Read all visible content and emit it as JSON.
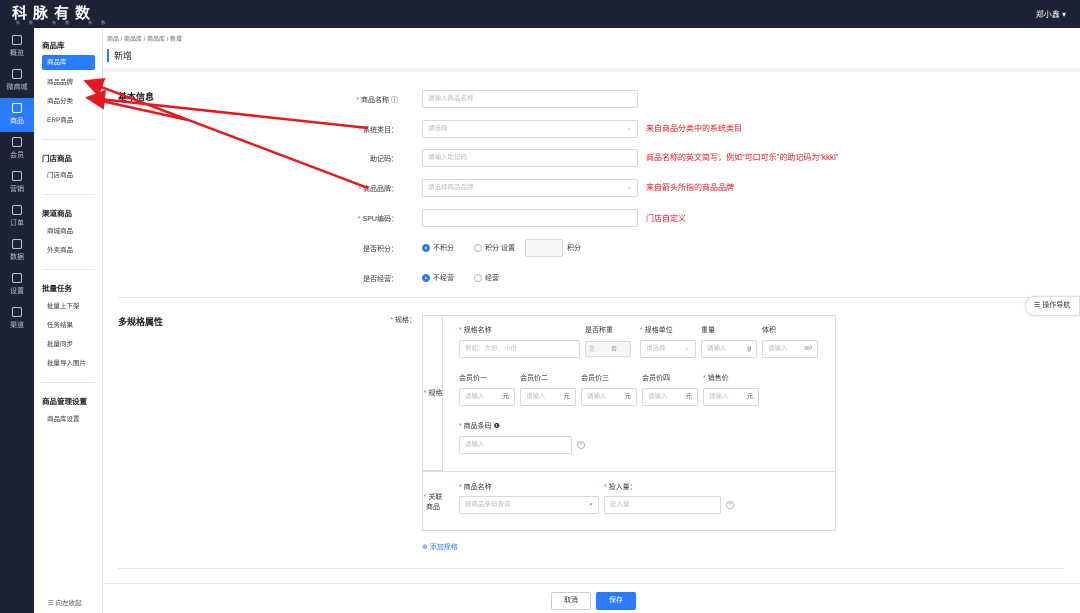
{
  "app": {
    "logo": "科脉有数",
    "logo_sub": "有数 有数 有数",
    "user": "郑小鑫 ▾"
  },
  "leftnav": [
    "概览",
    "微商城",
    "商品",
    "会员",
    "营销",
    "订单",
    "数据",
    "设置",
    "渠道"
  ],
  "subnav": {
    "groups": [
      "商品库",
      "门店商品",
      "渠道商品",
      "批量任务",
      "商品管理设置"
    ],
    "items": [
      "商品库",
      "商品品牌",
      "商品分类",
      "ERP商品",
      "门店商品",
      "商城商品",
      "外卖商品",
      "批量上下架",
      "任务结果",
      "批量同步",
      "批量导入图片",
      "商品库设置"
    ],
    "collapse": "☰ 向左收起"
  },
  "breadcrumb": "商品 / 商品库 / 商品库 / 新增",
  "page_title": "新增",
  "basic": {
    "section": "基本信息",
    "name_label": "商品名称",
    "name_placeholder": "请输入商品名称",
    "category_label": "系统类目：",
    "category_placeholder": "请选择",
    "category_note": "来自商品分类中的系统类目",
    "mnemonic_label": "助记码：",
    "mnemonic_placeholder": "请输入助记码",
    "mnemonic_note": "商品名称的英文简写，例如“可口可乐”的助记码为“kkkl”",
    "brand_label": "商品品牌：",
    "brand_placeholder": "请选择商品品牌",
    "brand_note": "来自箭头所指的商品品牌",
    "spu_label": "SPU编码：",
    "spu_note": "门店自定义",
    "points_label": "是否积分：",
    "points_opt1": "不积分",
    "points_opt2": "积分  设置",
    "points_unit": "积分",
    "consign_label": "是否经营：",
    "consign_opt1": "不经营",
    "consign_opt2": "经营"
  },
  "spec": {
    "section": "多规格属性",
    "spec_label": "规格：",
    "row_label": "规格",
    "name": "规格名称",
    "name_placeholder": "例如：大份、小份",
    "weigh": "是否称重",
    "weigh_opt1": "是",
    "weigh_opt2": "否",
    "unit": "规格单位",
    "unit_placeholder": "请选择",
    "weight": "重量",
    "weight_placeholder": "请输入",
    "weight_unit": "g",
    "volume": "体积",
    "volume_placeholder": "请输入",
    "volume_unit": "m³",
    "prices": [
      "会员价一",
      "会员价二",
      "会员价三",
      "会员价四"
    ],
    "sale_price": "销售价",
    "price_placeholder": "请输入",
    "price_unit": "元",
    "barcode": "商品条码",
    "barcode_placeholder": "请输入",
    "assoc_label": "关联商品",
    "assoc_name": "商品名称",
    "assoc_placeholder": "按商品条码查询",
    "assoc_qty": "投入量：",
    "assoc_qty_placeholder": "投入量",
    "add": "⊕ 添加规格"
  },
  "footer": {
    "cancel": "取消",
    "save": "保存"
  },
  "side_tool": "☰ 操作导航",
  "colors": {
    "primary": "#2a7cff",
    "nav_bg": "#1e2235",
    "note_red": "#e5191f"
  }
}
